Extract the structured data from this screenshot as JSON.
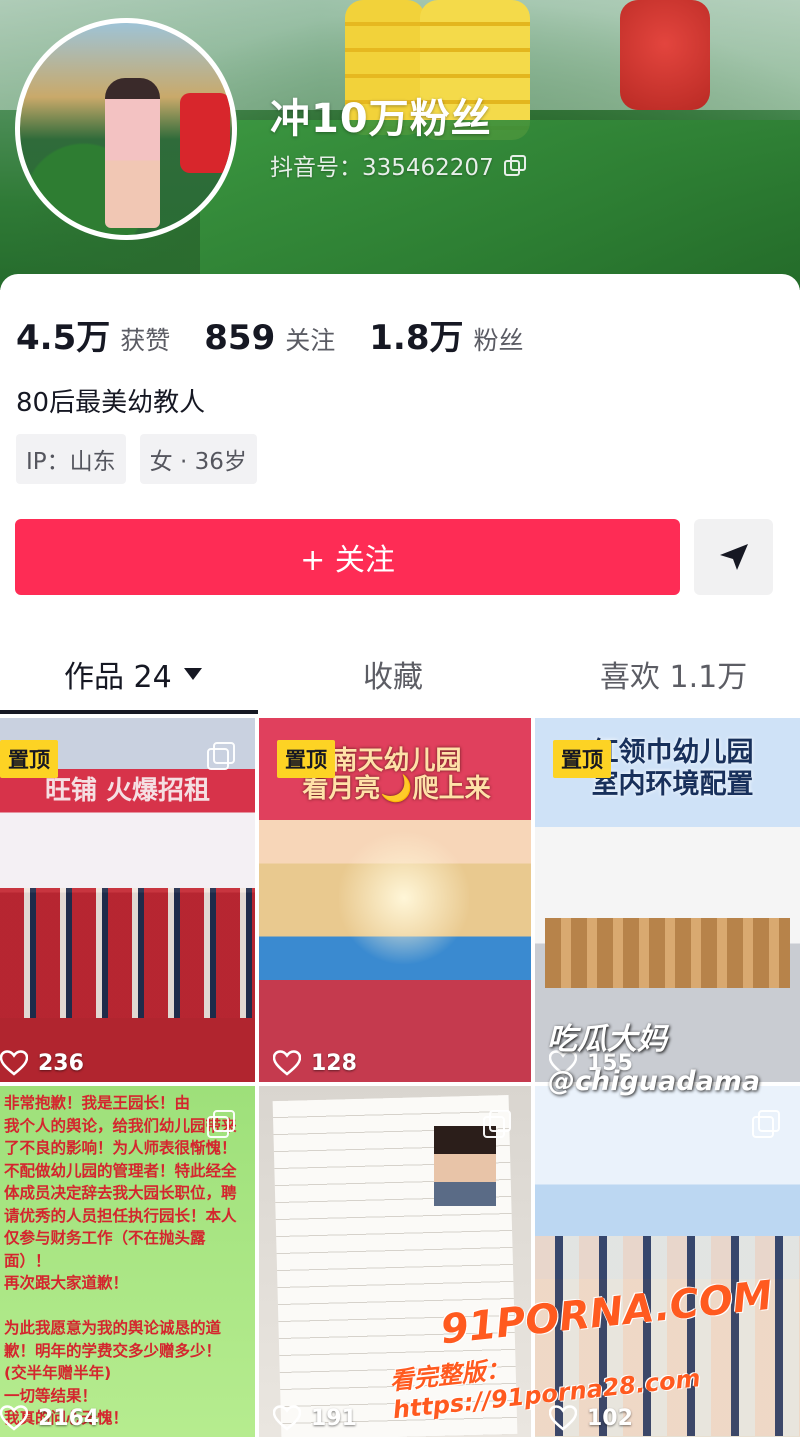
{
  "profile": {
    "name": "冲10万粉丝",
    "douyin_id": "抖音号：335462207",
    "bio": "80后最美幼教人",
    "tags": [
      "IP：山东",
      "女 · 36岁"
    ]
  },
  "stats": [
    {
      "value": "4.5万",
      "label": "获赞"
    },
    {
      "value": "859",
      "label": "关注"
    },
    {
      "value": "1.8万",
      "label": "粉丝"
    }
  ],
  "actions": {
    "follow_label": "+ 关注"
  },
  "tabs": [
    {
      "label": "作品 24"
    },
    {
      "label": "收藏"
    },
    {
      "label": "喜欢 1.1万"
    }
  ],
  "videos": [
    {
      "pinned": "置顶",
      "overlay": "旺铺 火爆招租",
      "likes": "236"
    },
    {
      "pinned": "置顶",
      "overlay": "南天幼儿园",
      "overlay2": "看月亮🌙爬上来",
      "likes": "128"
    },
    {
      "pinned": "置顶",
      "overlay": "红领巾幼儿园",
      "overlay2": "室内环境配置",
      "likes": "155"
    },
    {
      "notice": [
        "非常抱歉！我是王园长！由",
        "我个人的舆论，给我们幼儿园带来",
        "了不良的影响！为人师表很惭愧！",
        "不配做幼儿园的管理者！特此经全",
        "体成员决定辞去我大园长职位，聘",
        "请优秀的人员担任执行园长！本人",
        "仅参与财务工作（不在抛头露面）！",
        "再次跟大家道歉！",
        "",
        "为此我愿意为我的舆论诚恳的道",
        "歉！明年的学费交多少赠多少！",
        "(交半年赠半年)",
        "一切等结果！",
        "我真的问心无愧！"
      ],
      "likes": "2164"
    },
    {
      "likes": "191"
    },
    {
      "likes": "102"
    }
  ],
  "watermarks": {
    "w1": "吃瓜大妈",
    "w2": "@chiguadama",
    "w3": "91PORNA.COM",
    "w4": "看完整版：https://91porna28.com"
  },
  "colors": {
    "accent": "#fe2c55",
    "pin_badge": "#fdd324"
  }
}
